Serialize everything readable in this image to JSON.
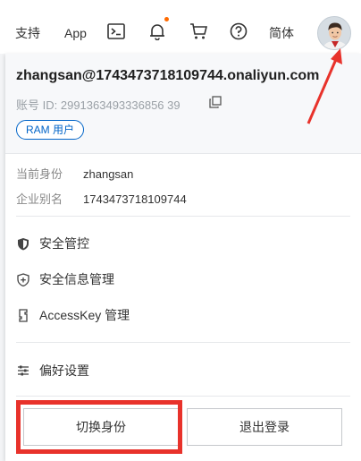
{
  "topbar": {
    "support": "支持",
    "app": "App",
    "lang": "简体",
    "icons": [
      "terminal-icon",
      "bell-icon",
      "cart-icon",
      "help-icon"
    ]
  },
  "account": {
    "email": "zhangsan@1743473718109744.onaliyun.com",
    "id_label": "账号 ID:",
    "id_value": "2991363493336856 39",
    "badge": "RAM 用户"
  },
  "identity": {
    "current_label": "当前身份",
    "current_value": "zhangsan",
    "alias_label": "企业别名",
    "alias_value": "1743473718109744"
  },
  "menu": {
    "security_control": "安全管控",
    "security_info": "安全信息管理",
    "accesskey": "AccessKey 管理",
    "preferences": "偏好设置"
  },
  "actions": {
    "switch_identity": "切换身份",
    "logout": "退出登录"
  },
  "colors": {
    "accent": "#0064c8",
    "annotation": "#e8322b",
    "notify": "#ff6a00"
  }
}
